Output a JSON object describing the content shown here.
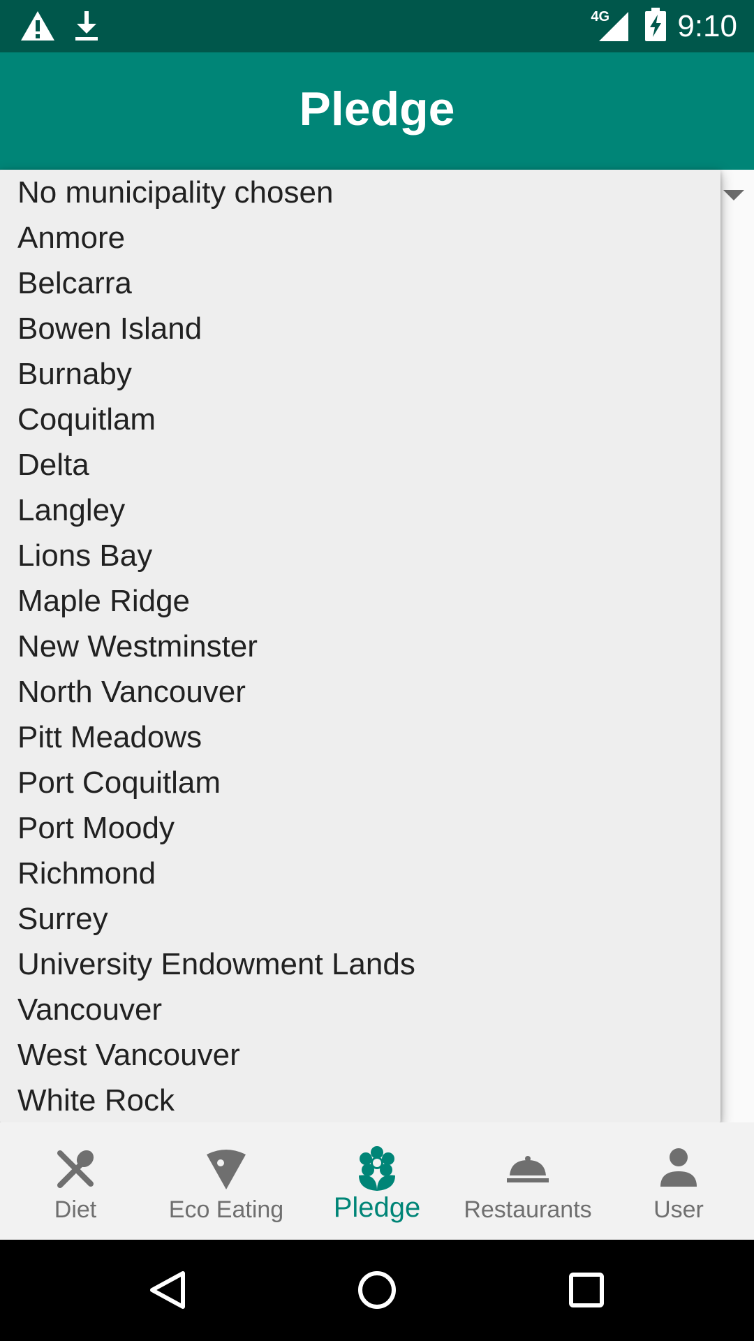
{
  "status_bar": {
    "time": "9:10",
    "network": "4G",
    "icons": [
      "warning-icon",
      "download-icon",
      "signal-icon",
      "battery-charging-icon"
    ]
  },
  "app_bar": {
    "title": "Pledge"
  },
  "dropdown": {
    "items": [
      "No municipality chosen",
      "Anmore",
      "Belcarra",
      "Bowen Island",
      "Burnaby",
      "Coquitlam",
      "Delta",
      "Langley",
      "Lions Bay",
      "Maple Ridge",
      "New Westminster",
      "North Vancouver",
      "Pitt Meadows",
      "Port Coquitlam",
      "Port Moody",
      "Richmond",
      "Surrey",
      "University Endowment Lands",
      "Vancouver",
      "West Vancouver",
      "White Rock"
    ]
  },
  "bottom_nav": {
    "items": [
      {
        "label": "Diet",
        "icon": "fork-knife-icon",
        "active": false
      },
      {
        "label": "Eco Eating",
        "icon": "pizza-slice-icon",
        "active": false
      },
      {
        "label": "Pledge",
        "icon": "flower-icon",
        "active": true
      },
      {
        "label": "Restaurants",
        "icon": "cloche-icon",
        "active": false
      },
      {
        "label": "User",
        "icon": "person-icon",
        "active": false
      }
    ]
  },
  "colors": {
    "status_bar": "#00574b",
    "primary": "#008577",
    "inactive": "#6f6f6f"
  }
}
